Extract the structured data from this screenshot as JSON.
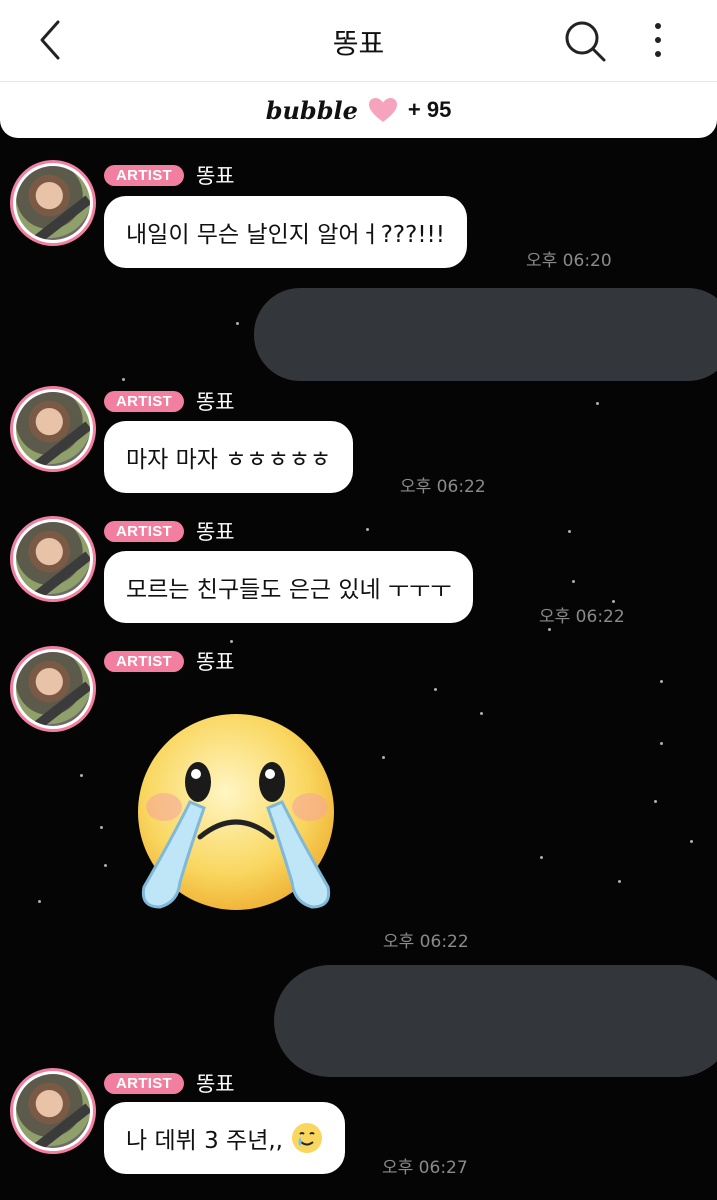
{
  "header": {
    "title": "똥표",
    "bubble_logo": "bubble",
    "bubble_count": "+ 95"
  },
  "messages": [
    {
      "badge": "ARTIST",
      "name": "똥표",
      "text": "내일이 무슨 날인지 알어ㅓ???!!!",
      "time": "오후 06:20"
    },
    {
      "badge": "ARTIST",
      "name": "똥표",
      "text": "마자 마자 ㅎㅎㅎㅎㅎ",
      "time": "오후 06:22"
    },
    {
      "badge": "ARTIST",
      "name": "똥표",
      "text": "모르는 친구들도 은근 있네 ㅜㅜㅜ",
      "time": "오후 06:22"
    },
    {
      "badge": "ARTIST",
      "name": "똥표",
      "emoji": "crying-face-icon",
      "time": "오후 06:22"
    },
    {
      "badge": "ARTIST",
      "name": "똥표",
      "text": "나 데뷔 3 주년,,",
      "time": "오후 06:27"
    }
  ],
  "icons": {
    "back": "chevron-left-icon",
    "search": "search-icon",
    "more": "more-vertical-icon",
    "heart": "heart-icon"
  },
  "colors": {
    "accent_pink": "#f27ea0",
    "background": "#050505",
    "sent_bubble": "#33363b"
  }
}
